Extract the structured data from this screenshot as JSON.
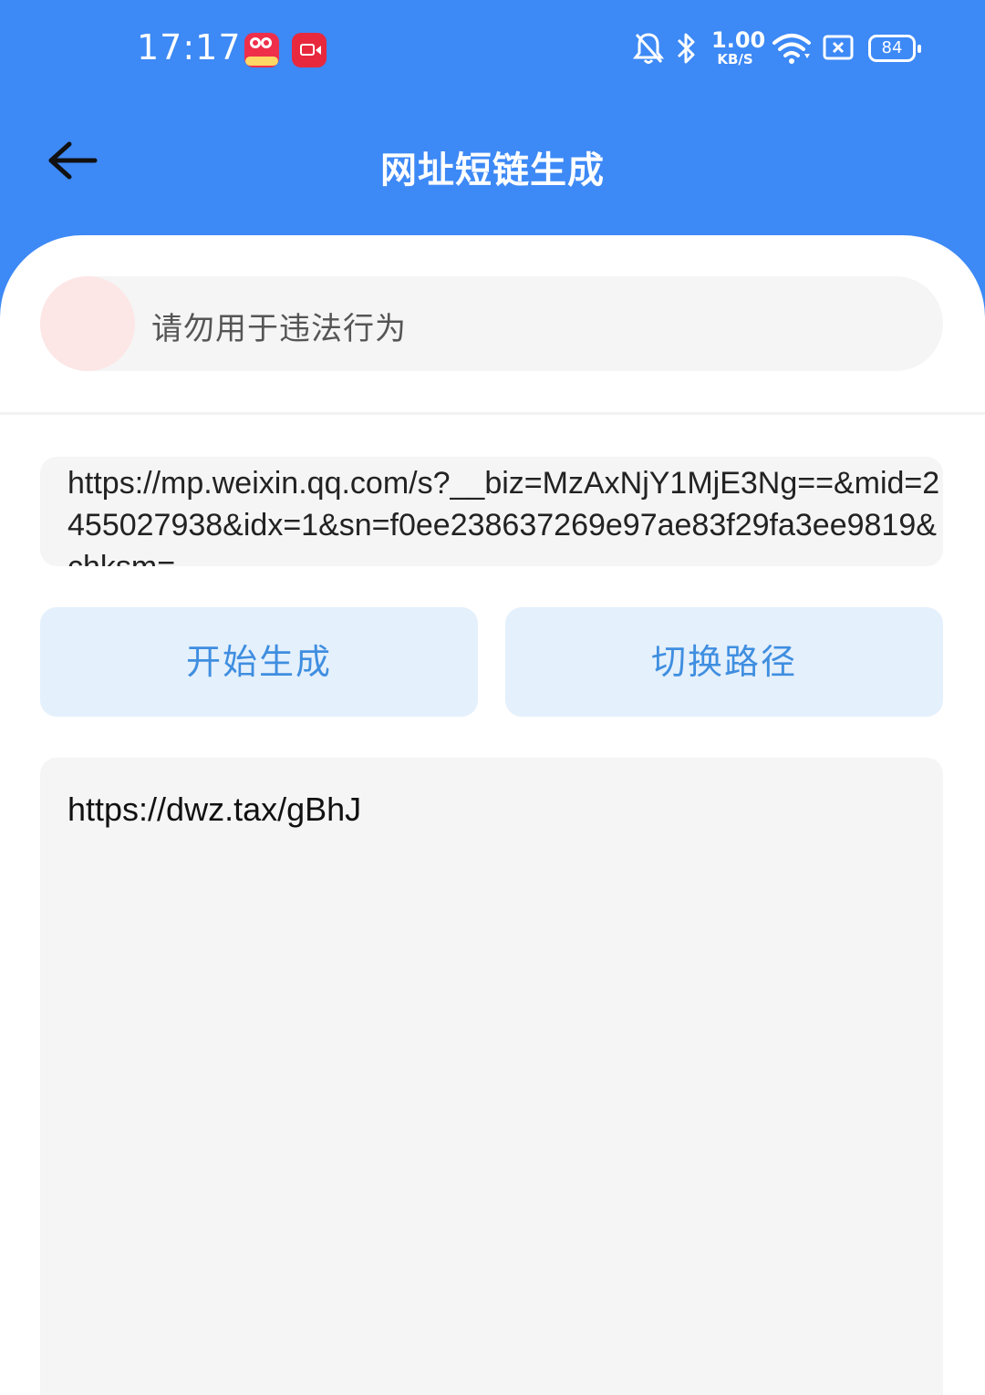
{
  "status_bar": {
    "time": "17:17",
    "app_icons": [
      "kuaishou-icon",
      "screen-recorder-icon"
    ],
    "net_speed_value": "1.00",
    "net_speed_unit": "KB/S",
    "battery_level": "84",
    "icons": [
      "bell-muted-icon",
      "bluetooth-icon",
      "wifi-icon",
      "sim-blocked-icon",
      "battery-icon"
    ]
  },
  "app_bar": {
    "title": "网址短链生成",
    "back_icon": "arrow-left-icon"
  },
  "notice": {
    "text": "请勿用于违法行为"
  },
  "url_input": {
    "value": "https://mp.weixin.qq.com/s?__biz=MzAxNjY1MjE3Ng==&mid=2455027938&idx=1&sn=f0ee238637269e97ae83f29fa3ee9819&chksm="
  },
  "buttons": {
    "generate_label": "开始生成",
    "switch_label": "切换路径"
  },
  "result": {
    "value": "https://dwz.tax/gBhJ"
  },
  "colors": {
    "primary": "#3d89f6",
    "button_bg": "#e4f0fc",
    "button_text": "#3f8ee0",
    "field_bg": "#f5f5f5"
  }
}
